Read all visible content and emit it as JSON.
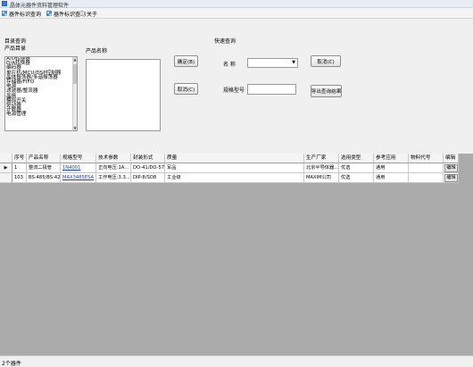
{
  "window": {
    "title": "晶体元器件资料管理软件"
  },
  "menu": {
    "items": [
      {
        "label": "器件标识查询",
        "icon": "grid-icon"
      },
      {
        "label": "器件标识查询",
        "icon": "grid-icon"
      },
      {
        "label": "关于",
        "icon": "info-icon"
      }
    ]
  },
  "query": {
    "section_title": "目录查询",
    "catalog_label": "产品目录",
    "catalog_items": [
      "A/D转换器",
      "D/A转换器",
      "编码器",
      "单片机/MCU/DSP控制器",
      "晶体振荡器/多谐振荡器",
      "存储器/FIFO",
      "电源",
      "滤波器/整流器",
      "晶振",
      "模拟开关",
      "驱动器",
      "计数器",
      "电源管理"
    ],
    "product_label": "产品名称",
    "confirm_button": "确定(B)",
    "cancel_button": "取消(C)"
  },
  "quick_query": {
    "section_title": "快速查询",
    "name_label": "名 称",
    "name_value": "",
    "model_label": "规格型号",
    "model_value": "",
    "cancel_button": "取消(C)",
    "export_button": "导出查询结果"
  },
  "grid": {
    "columns": [
      "序号",
      "产品名称",
      "规格型号",
      "技术参数",
      "封装形式",
      "质量",
      "生产厂家",
      "选用类型",
      "参考应用",
      "物料代号",
      "编辑"
    ],
    "rows": [
      {
        "id": "1",
        "name": "整流二极管",
        "model": "1N4001",
        "params": "正向电压:1A...",
        "package": "DO-41/DO-57...",
        "quality": "军品",
        "maker": "北京半导体器...",
        "type": "优选",
        "app": "通用",
        "code": "",
        "edit": "编辑",
        "current": true
      },
      {
        "id": "103",
        "name": "BS-485/BS-42...",
        "model": "MAX3485ESA",
        "params": "工作电压:3.3...",
        "package": "DIP-8/SO8",
        "quality": "工业级",
        "maker": "MAXIM公司",
        "type": "优选",
        "app": "通用",
        "code": "",
        "edit": "编辑",
        "current": false
      }
    ]
  },
  "status": {
    "text": "2个器件"
  },
  "colors": {
    "selection": "#3399ff",
    "link": "#1a3fb0",
    "grid_background": "#ababab"
  }
}
